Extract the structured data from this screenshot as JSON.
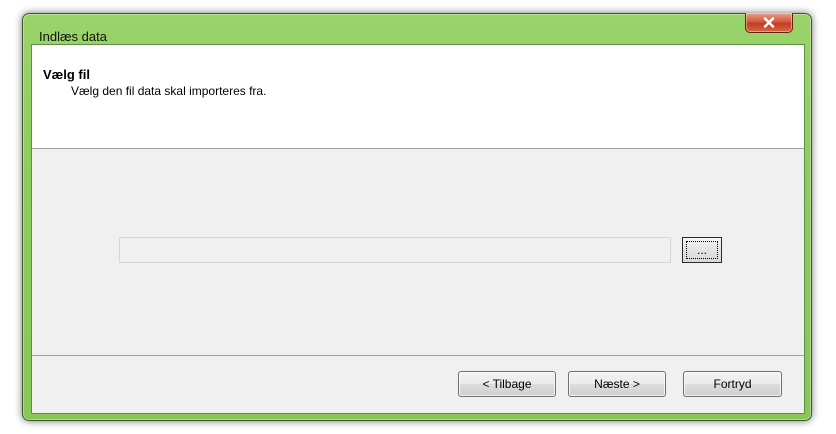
{
  "window": {
    "title": "Indlæs data",
    "close_icon": "close-icon"
  },
  "header": {
    "title": "Vælg fil",
    "subtitle": "Vælg den fil data skal importeres fra."
  },
  "file_picker": {
    "value": "",
    "browse_label": "..."
  },
  "buttons": {
    "back": "< Tilbage",
    "next": "Næste >",
    "cancel": "Fortryd"
  },
  "colors": {
    "frame": "#8ccc5c",
    "close_button": "#c94a2e",
    "client_background": "#f0f0f0",
    "header_background": "#ffffff"
  }
}
